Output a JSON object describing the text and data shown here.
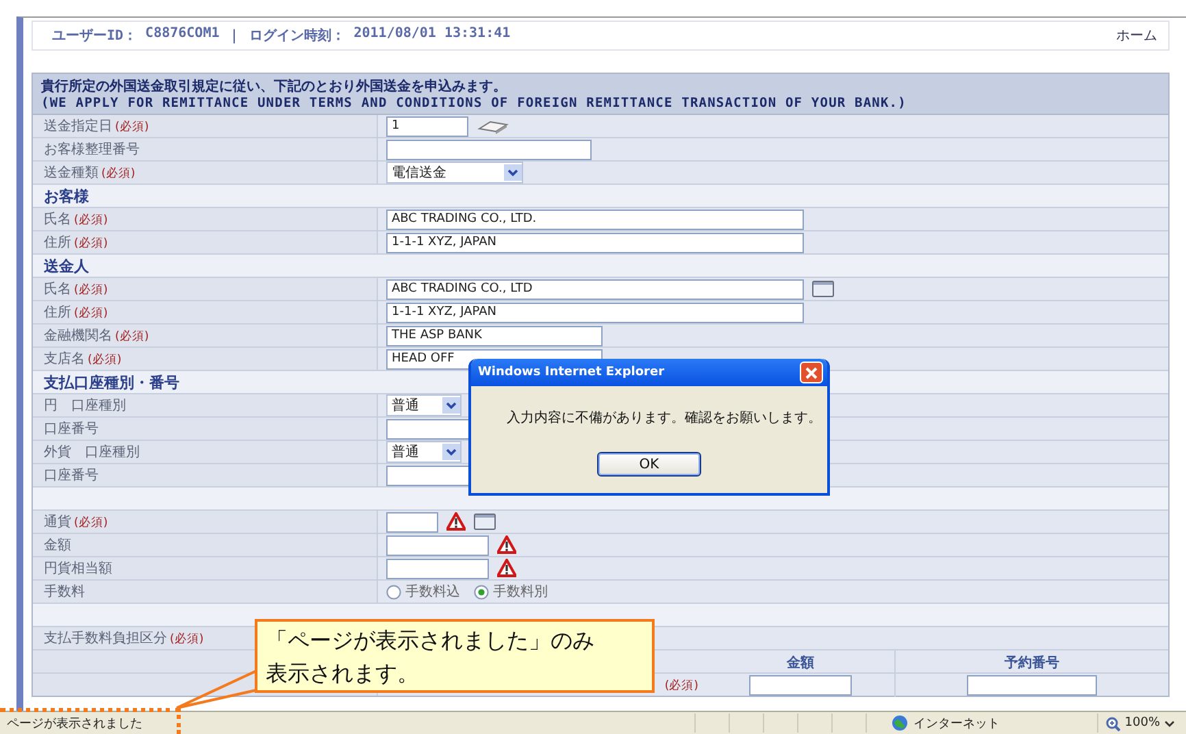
{
  "header": {
    "user_id_label": "ユーザーID：",
    "user_id": "C8876COM1",
    "separator": "｜",
    "login_label": "ログイン時刻：",
    "login_time": "2011/08/01 13:31:41",
    "home_link": "ホーム"
  },
  "intro": [
    "貴行所定の外国送金取引規定に従い、下記のとおり外国送金を申込みます。",
    "(WE APPLY FOR REMITTANCE UNDER TERMS AND CONDITIONS OF FOREIGN REMITTANCE TRANSACTION OF YOUR BANK.)"
  ],
  "form": {
    "rows": [
      {
        "kind": "date",
        "label": "送金指定日",
        "required": "(必須)",
        "value": "1"
      },
      {
        "kind": "ref",
        "label": "お客様整理番号"
      },
      {
        "kind": "select",
        "label": "送金種類",
        "required": "(必須)",
        "value": "電信送金"
      },
      {
        "kind": "section",
        "label": "お客様"
      },
      {
        "kind": "name",
        "label": "氏名",
        "required": "(必須)",
        "value": "ABC TRADING CO., LTD."
      },
      {
        "kind": "name",
        "label": "住所",
        "required": "(必須)",
        "value": "1-1-1 XYZ, JAPAN"
      },
      {
        "kind": "section",
        "label": "送金人"
      },
      {
        "kind": "name-card",
        "label": "氏名",
        "required": "(必須)",
        "value": "ABC TRADING CO., LTD"
      },
      {
        "kind": "name",
        "label": "住所",
        "required": "(必須)",
        "value": "1-1-1 XYZ, JAPAN"
      },
      {
        "kind": "bank",
        "label": "金融機関名",
        "required": "(必須)",
        "value": "THE ASP BANK"
      },
      {
        "kind": "bank",
        "label": "支店名",
        "required": "(必須)",
        "value": "HEAD OFF"
      },
      {
        "kind": "section",
        "label": "支払口座種別・番号"
      },
      {
        "kind": "select-small",
        "label": "円　口座種別",
        "value": "普通"
      },
      {
        "kind": "account",
        "label": "口座番号"
      },
      {
        "kind": "select-small",
        "label": "外貨　口座種別",
        "value": "普通"
      },
      {
        "kind": "account",
        "label": "口座番号"
      },
      {
        "kind": "blank"
      },
      {
        "kind": "currency",
        "label": "通貨",
        "required": "(必須)"
      },
      {
        "kind": "amount",
        "label": "金額"
      },
      {
        "kind": "amount",
        "label": "円貨相当額"
      },
      {
        "kind": "radio",
        "label": "手数料",
        "options": [
          {
            "label": "手数料込",
            "selected": false
          },
          {
            "label": "手数料別",
            "selected": true
          }
        ]
      },
      {
        "kind": "blank"
      },
      {
        "kind": "label-only",
        "label": "支払手数料負担区分",
        "required": "(必須)"
      },
      {
        "kind": "split-header",
        "columns": [
          "金額",
          "予約番号"
        ]
      },
      {
        "kind": "split-input",
        "required": "(必須)"
      }
    ]
  },
  "dialog": {
    "title": "Windows Internet Explorer",
    "message": "入力内容に不備があります。確認をお願いします。",
    "button": "OK"
  },
  "callout": {
    "lines": [
      "「ページが表示されました」のみ",
      "表示されます。"
    ]
  },
  "status_bar": {
    "message": "ページが表示されました",
    "zone": "インターネット",
    "zoom": "100%"
  }
}
